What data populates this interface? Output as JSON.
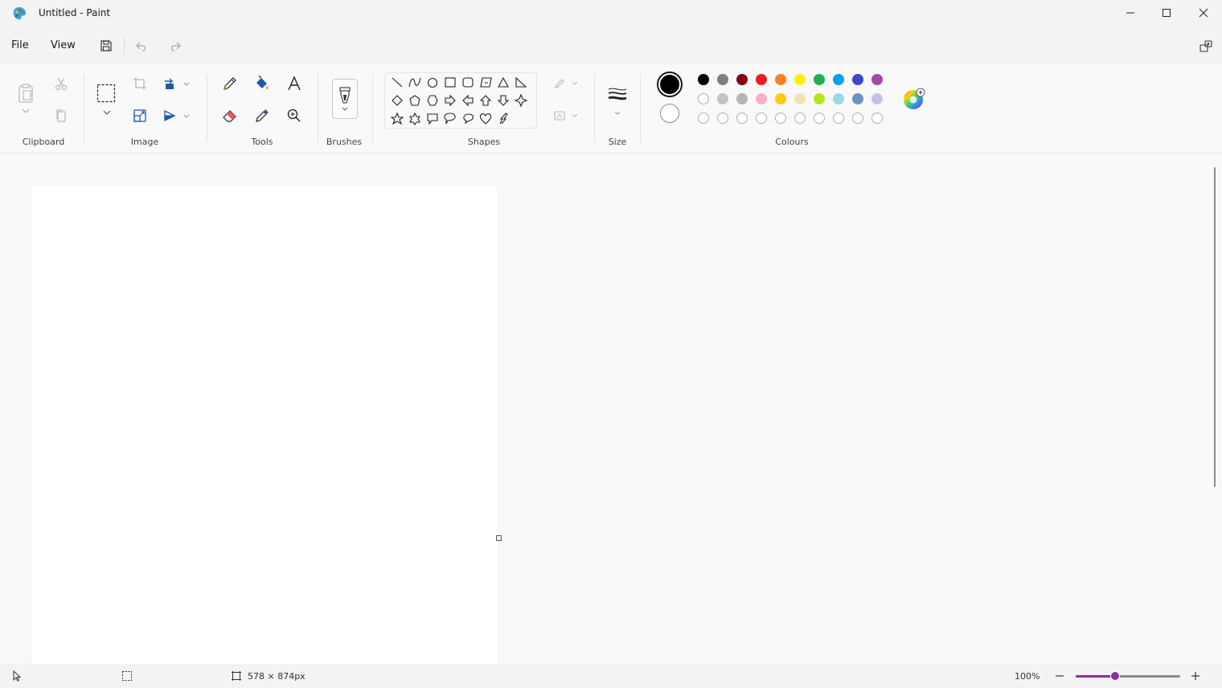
{
  "window": {
    "title": "Untitled - Paint",
    "app_icon": "paint-palette-icon",
    "controls": [
      "minimize-icon",
      "maximize-icon",
      "close-icon"
    ]
  },
  "menu": {
    "file_label": "File",
    "view_label": "View",
    "quick_actions": [
      "save-icon",
      "undo-icon",
      "redo-icon"
    ],
    "right_icon": "share-icon"
  },
  "ribbon": {
    "groups": {
      "clipboard": "Clipboard",
      "image": "Image",
      "tools": "Tools",
      "brushes": "Brushes",
      "shapes": "Shapes",
      "size": "Size",
      "colours": "Colours"
    }
  },
  "colours": {
    "primary": "#000000",
    "secondary": "#ffffff",
    "row1": [
      "#000000",
      "#7f7f7f",
      "#880015",
      "#ed1c24",
      "#ff7f27",
      "#fff200",
      "#22b14c",
      "#00a2e8",
      "#3f48cc",
      "#a349a4"
    ],
    "row2": [
      "#ffffff",
      "#c3c3c3",
      "#b5b5b5",
      "#ffaec9",
      "#ffc90e",
      "#efe4b0",
      "#b5e61d",
      "#99d9ea",
      "#7092be",
      "#c8bfe7"
    ],
    "row3_empty_count": 10
  },
  "status": {
    "canvas_size": "578 × 874px",
    "zoom": "100%",
    "zoom_fraction": 0.38
  }
}
